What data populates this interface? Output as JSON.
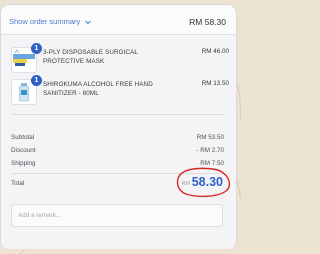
{
  "summary": {
    "toggle_label": "Show order summary",
    "total": "RM 58.30"
  },
  "items": [
    {
      "quantity": "1",
      "name": "3-PLY DISPOSABLE SURGICAL PROTECTIVE MASK",
      "price": "RM 46.00"
    },
    {
      "quantity": "1",
      "name": "SHIROKUMA ALCOHOL FREE HAND SANITIZER - 80ML",
      "price": "RM 13.50"
    }
  ],
  "totals": {
    "subtotal_label": "Subtotal",
    "subtotal_value": "RM 53.50",
    "discount_label": "Discount",
    "discount_value": "- RM 2.70",
    "shipping_label": "Shipping",
    "shipping_value": "RM 7.50",
    "total_label": "Total",
    "total_currency": "RM",
    "total_amount": "58.30"
  },
  "remark": {
    "placeholder": "Add a remark..."
  },
  "colors": {
    "accent": "#2e63c9",
    "annotation": "#d42a2a"
  }
}
